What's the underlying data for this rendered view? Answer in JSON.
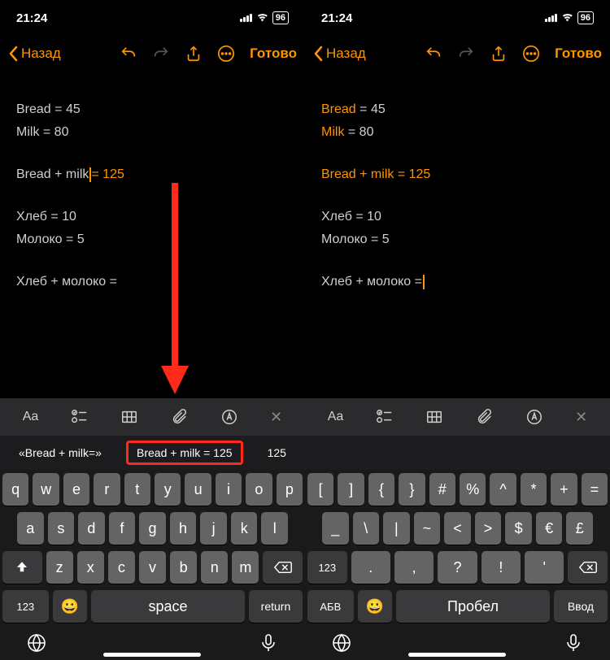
{
  "status": {
    "time": "21:24",
    "battery": "96"
  },
  "nav": {
    "back": "Назад",
    "done": "Готово"
  },
  "note": {
    "left": {
      "l1a": "Bread",
      "l1b": " = 45",
      "l2a": "Milk",
      "l2b": " = 80",
      "l3a": "Bread + milk",
      "l3b": "= 125",
      "l4": "Хлеб = 10",
      "l5": "Молоко = 5",
      "l6": "Хлеб + молоко ="
    },
    "right": {
      "l1a": "Bread",
      "l1b": " = 45",
      "l2a": "Milk",
      "l2b": " = 80",
      "l3a": "Bread + milk = 125",
      "l4": "Хлеб = 10",
      "l5": "Молоко = 5",
      "l6": "Хлеб + молоко ="
    }
  },
  "format": {
    "aa": "Aa"
  },
  "suggest": {
    "left": {
      "s1": "«Bread + milk=»",
      "s2": "Bread + milk = 125",
      "s3": "125"
    }
  },
  "kb_left": {
    "r1": [
      "q",
      "w",
      "e",
      "r",
      "t",
      "y",
      "u",
      "i",
      "o",
      "p"
    ],
    "r2": [
      "a",
      "s",
      "d",
      "f",
      "g",
      "h",
      "j",
      "k",
      "l"
    ],
    "r3": [
      "z",
      "x",
      "c",
      "v",
      "b",
      "n",
      "m"
    ],
    "num": "123",
    "space": "space",
    "return": "return"
  },
  "kb_right": {
    "r1": [
      "[",
      "]",
      "{",
      "}",
      "#",
      "%",
      "^",
      "*",
      "+",
      "="
    ],
    "r2": [
      "_",
      "\\",
      "|",
      "~",
      "<",
      ">",
      "$",
      "€",
      "£"
    ],
    "r3": [
      ".",
      ",",
      "?",
      "!",
      "'"
    ],
    "num": "123",
    "abc": "АБВ",
    "space": "Пробел",
    "return": "Ввод"
  }
}
